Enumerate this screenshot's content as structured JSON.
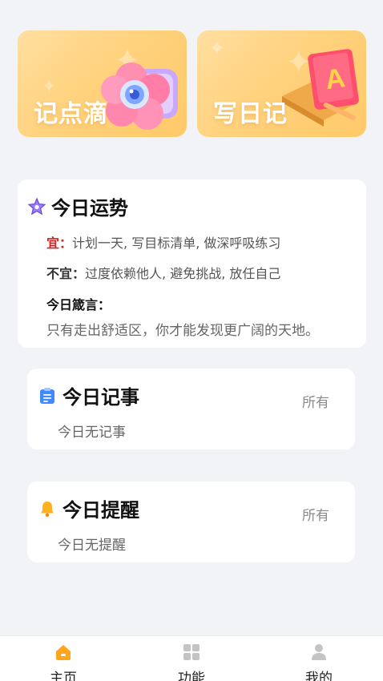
{
  "cards": [
    {
      "title": "记点滴",
      "icon": "camera-icon"
    },
    {
      "title": "写日记",
      "icon": "diary-book-icon"
    }
  ],
  "fortune": {
    "title": "今日运势",
    "icon": "star-icon",
    "yi_label": "宜：",
    "yi_text": "计划一天, 写目标清单, 做深呼吸练习",
    "buyi_label": "不宜：",
    "buyi_text": "过度依赖他人, 避免挑战, 放任自己",
    "quote_label": "今日箴言：",
    "quote_text": "只有走出舒适区，你才能发现更广阔的天地。"
  },
  "memo": {
    "title": "今日记事",
    "icon": "clipboard-icon",
    "all_label": "所有",
    "empty_text": "今日无记事"
  },
  "reminder": {
    "title": "今日提醒",
    "icon": "bell-icon",
    "all_label": "所有",
    "empty_text": "今日无提醒"
  },
  "tabs": [
    {
      "label": "主页",
      "icon": "home-icon",
      "active": true
    },
    {
      "label": "功能",
      "icon": "grid-icon",
      "active": false
    },
    {
      "label": "我的",
      "icon": "user-icon",
      "active": false
    }
  ],
  "colors": {
    "accent": "#f5a623",
    "card_gradient_start": "#ffdfa0",
    "card_gradient_end": "#ffc968",
    "yi_red": "#d02424",
    "page_bg": "#f2f3f6"
  }
}
